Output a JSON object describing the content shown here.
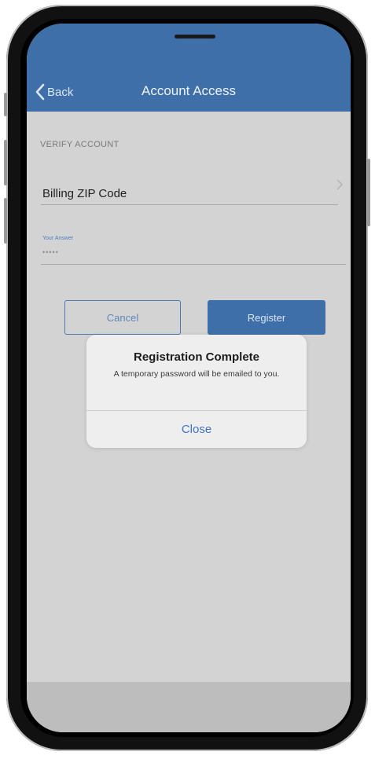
{
  "nav": {
    "back_label": "Back",
    "title": "Account Access"
  },
  "form": {
    "section_header": "VERIFY ACCOUNT",
    "zip_label": "Billing ZIP Code",
    "hint_label": "Your Answer",
    "masked_value": "•••••"
  },
  "buttons": {
    "cancel": "Cancel",
    "register": "Register"
  },
  "alert": {
    "title": "Registration Complete",
    "message": "A temporary password will be emailed to you.",
    "close": "Close"
  },
  "colors": {
    "brand_blue": "#3f6fa8",
    "link_blue": "#3f73c0",
    "screen_gray": "#d3d3d3"
  },
  "icons": {
    "back": "chevron-left-icon",
    "row": "chevron-right-icon"
  }
}
